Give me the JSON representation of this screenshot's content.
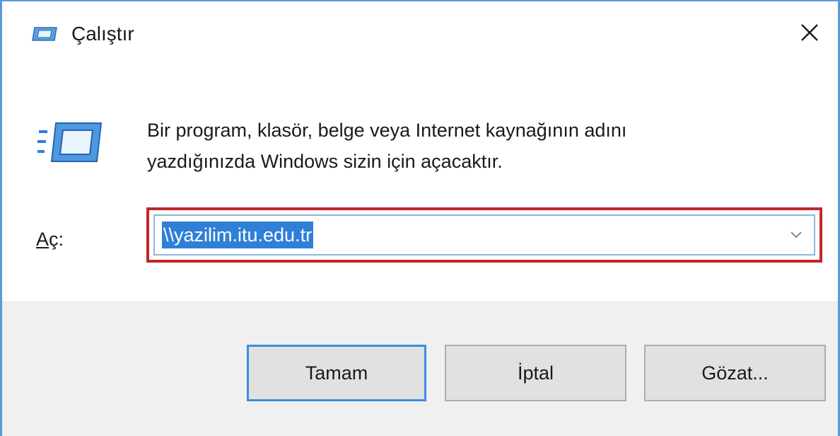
{
  "window": {
    "title": "Çalıştır"
  },
  "content": {
    "description_line1": "Bir program, klasör, belge veya Internet kaynağının adını",
    "description_line2": "yazdığınızda Windows sizin için açacaktır.",
    "open_label_accel": "A",
    "open_label_rest": "ç:",
    "open_value": "\\\\yazilim.itu.edu.tr"
  },
  "buttons": {
    "ok": "Tamam",
    "cancel": "İptal",
    "browse": "Gözat..."
  },
  "colors": {
    "accent": "#2f7fd8",
    "highlight_border": "#c1272d",
    "window_border": "#5b9bd5"
  },
  "icons": {
    "title": "run-icon",
    "content": "run-icon",
    "close": "close-icon",
    "dropdown": "chevron-down-icon"
  }
}
